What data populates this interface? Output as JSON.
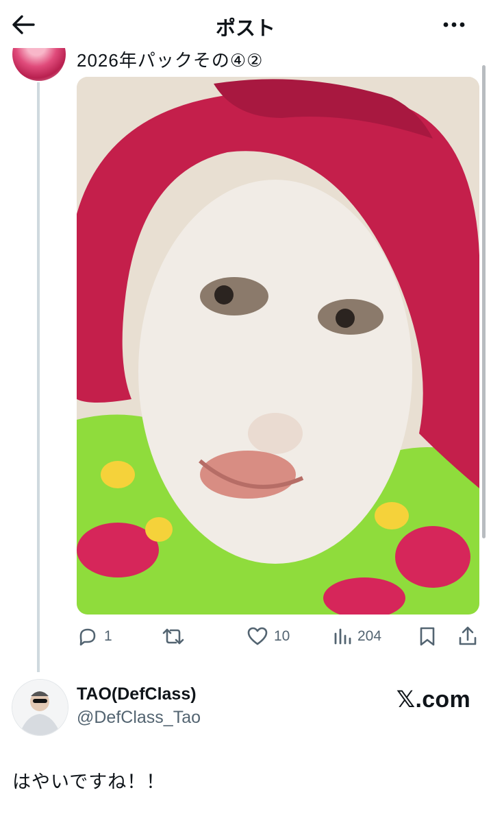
{
  "header": {
    "title": "ポスト",
    "back_icon": "arrow-left-icon",
    "more_icon": "more-horizontal-icon"
  },
  "post": {
    "text": "2026年パックその④②",
    "image_alt": "",
    "actions": {
      "replies": "1",
      "reposts": "",
      "likes": "10",
      "views": "204"
    }
  },
  "quote": {
    "name": "TAO(DefClass)",
    "handle": "@DefClass_Tao",
    "site": "𝕏.com",
    "reply_text": "はやいですね！！"
  },
  "colors": {
    "text": "#0f1419",
    "muted": "#536471",
    "thread_line": "#cfd9de"
  }
}
